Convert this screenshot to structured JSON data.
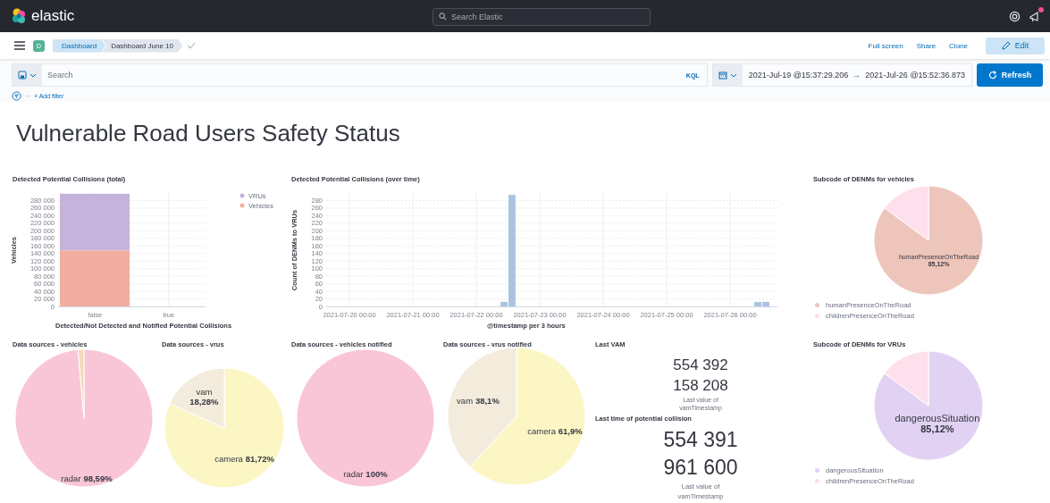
{
  "header": {
    "logo": "elastic",
    "search": {
      "placeholder": "Search Elastic"
    },
    "newsfeed_unread": true
  },
  "breadcrumb_bar": {
    "avatar": "D",
    "breadcrumbs": [
      {
        "label": "Dashboard",
        "selected": false
      },
      {
        "label": "Dashboard June 10",
        "selected": true
      }
    ],
    "actions": [
      "Full screen",
      "Share",
      "Clone"
    ],
    "edit_button": "Edit"
  },
  "query_bar": {
    "search": {
      "placeholder": "Search"
    },
    "language": "KQL",
    "start": "2021-Jul-19 @15:37:29.206",
    "arrow": "→",
    "end": "2021-Jul-26 @15:52:36.873",
    "refresh_button": "Refresh",
    "add_filter": "+ Add filter"
  },
  "title": "Vulnerable Road Users Safety Status",
  "panels": [
    {
      "kind": "chart",
      "title": "Detected Potential Collisions (total)",
      "chart_data": {
        "type": "bar",
        "stacked": true,
        "grid": true,
        "xlabel": "Detected/Not Detected and Notified Potential Collisions",
        "ylabel": "Vehicles",
        "categories": [
          "false",
          "true"
        ],
        "series": [
          {
            "name": "VRUs",
            "color": "#c6b3dc",
            "values": [
              150000,
              0
            ]
          },
          {
            "name": "Vehicles",
            "color": "#f1aea0",
            "values": [
              148000,
              0
            ]
          }
        ],
        "ylim": [
          0,
          300000
        ],
        "yticks": [
          {
            "value": 0,
            "label": "0"
          },
          {
            "value": 20000,
            "label": "20 000"
          },
          {
            "value": 40000,
            "label": "40 000"
          },
          {
            "value": 60000,
            "label": "60 000"
          },
          {
            "value": 80000,
            "label": "80 000"
          },
          {
            "value": 100000,
            "label": "100 000"
          },
          {
            "value": 120000,
            "label": "120 000"
          },
          {
            "value": 140000,
            "label": "140 000"
          },
          {
            "value": 160000,
            "label": "160 000"
          },
          {
            "value": 180000,
            "label": "180 000"
          },
          {
            "value": 200000,
            "label": "200 000"
          },
          {
            "value": 220000,
            "label": "220 000"
          },
          {
            "value": 240000,
            "label": "240 000"
          },
          {
            "value": 260000,
            "label": "260 000"
          },
          {
            "value": 280000,
            "label": "280 000"
          }
        ]
      }
    },
    {
      "kind": "chart",
      "title": "Detected Potential Collisions (over time)",
      "chart_data": {
        "type": "bar",
        "grid": true,
        "xlabel": "@timestamp per 3 hours",
        "ylabel": "Count of DENMs to VRUs",
        "x": [
          "2021-07-22 10:30",
          "2021-07-22 13:30",
          "2021-07-26 10:30",
          "2021-07-26 13:30"
        ],
        "values": [
          12,
          295,
          12,
          12
        ],
        "xlim": [
          "2021-07-19 15:13",
          "2021-07-26 17:54"
        ],
        "ylim": [
          0,
          300
        ],
        "xticks": [
          "2021-07-20 00:00",
          "2021-07-21 00:00",
          "2021-07-22 00:00",
          "2021-07-23 00:00",
          "2021-07-24 00:00",
          "2021-07-25 00:00",
          "2021-07-26 00:00"
        ],
        "yticks": [
          0,
          20,
          40,
          60,
          80,
          100,
          120,
          140,
          160,
          180,
          200,
          220,
          240,
          260,
          280
        ]
      }
    },
    {
      "kind": "chart",
      "title": "Subcode of DENMs for vehicles",
      "legend": true,
      "chart_data": {
        "type": "pie",
        "categories": [
          "humanPresenceOnTheRoad",
          "childrenPresenceOnTheRoad"
        ],
        "values": [
          85.12,
          14.88
        ],
        "colors": [
          "#eec5bb",
          "#fde0ec"
        ],
        "value_labels": [
          "85,12%",
          null
        ]
      }
    },
    {
      "kind": "chart",
      "title": "Data sources - vehicles",
      "chart_data": {
        "type": "pie",
        "categories": [
          "radar",
          null
        ],
        "values": [
          98.59,
          1.41
        ],
        "colors": [
          "#f9c6d7",
          "#f7d9b7"
        ],
        "value_labels": [
          "98,59%",
          null
        ]
      }
    },
    {
      "kind": "chart",
      "title": "Data sources - vrus",
      "chart_data": {
        "type": "pie",
        "categories": [
          "camera",
          "vam"
        ],
        "values": [
          81.72,
          18.28
        ],
        "colors": [
          "#fcf6c4",
          "#f3ebdc"
        ],
        "value_labels": [
          "81,72%",
          "18,28%"
        ]
      }
    },
    {
      "kind": "chart",
      "title": "Data sources - vehicles notified",
      "chart_data": {
        "type": "pie",
        "categories": [
          "radar"
        ],
        "values": [
          100
        ],
        "colors": [
          "#f9c6d7"
        ],
        "value_labels": [
          "100%"
        ]
      }
    },
    {
      "kind": "chart",
      "title": "Data sources - vrus notified",
      "chart_data": {
        "type": "pie",
        "categories": [
          "camera",
          "vam"
        ],
        "values": [
          61.9,
          38.1
        ],
        "colors": [
          "#fcf6c4",
          "#f3ebdc"
        ],
        "value_labels": [
          "61,9%",
          "38,1%"
        ]
      }
    },
    {
      "kind": "metric",
      "title": "Last VAM",
      "value": "554 392 158 208",
      "label": "Last value of vamTimestamp"
    },
    {
      "kind": "metric",
      "title": "Last time of potential collision",
      "value": "554 391 961 600",
      "label": "Last value of vamTimestamp"
    },
    {
      "kind": "chart",
      "title": "Subcode of DENMs for VRUs",
      "legend": true,
      "chart_data": {
        "type": "pie",
        "categories": [
          "dangerousSituation",
          "childrenPresenceOnTheRoad"
        ],
        "values": [
          85.12,
          14.88
        ],
        "colors": [
          "#e1d2f3",
          "#fde0ec"
        ],
        "value_labels": [
          "85,12%",
          null
        ]
      }
    }
  ]
}
